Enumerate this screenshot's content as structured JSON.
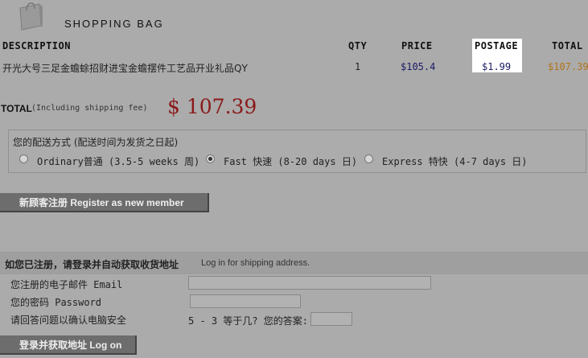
{
  "header": {
    "title": "SHOPPING BAG",
    "icon": "shopping-bag-icon"
  },
  "table": {
    "columns": [
      "DESCRIPTION",
      "QTY",
      "PRICE",
      "POSTAGE",
      "TOTAL"
    ],
    "row": {
      "description": "开光大号三足金蟾蜍招财进宝金蟾摆件工艺品开业礼品QY",
      "qty": "1",
      "price": "$105.4",
      "postage": "$1.99",
      "total": "$107.39"
    },
    "colors": {
      "price": "#1a1a66",
      "postage": "#1a1a66",
      "total": "#b3741b"
    }
  },
  "summary": {
    "label": "TOTAL",
    "note": "(Including shipping fee)",
    "amount": "$ 107.39",
    "amount_color": "#8b1a1a"
  },
  "shipping": {
    "title": "您的配送方式 (配送时间为发货之日起)",
    "options": [
      {
        "label": "Ordinary普通 (3.5-5 weeks 周)",
        "checked": false
      },
      {
        "label": "Fast 快速 (8-20 days 日)",
        "checked": true
      },
      {
        "label": "Express 特快 (4-7 days 日)",
        "checked": false
      }
    ]
  },
  "register": {
    "label": "新顾客注册 Register as new member"
  },
  "login": {
    "title": "如您已注册，请登录并自动获取收货地址",
    "subtitle": "Log in for shipping address.",
    "email_label": "您注册的电子邮件 Email",
    "email_value": "",
    "password_label": "您的密码 Password",
    "password_value": "",
    "captcha_label": "请回答问题以确认电脑安全",
    "captcha_question": "5 - 3 等于几? 您的答案:",
    "captcha_value": "",
    "button_label": "登录并获取地址 Log on"
  }
}
